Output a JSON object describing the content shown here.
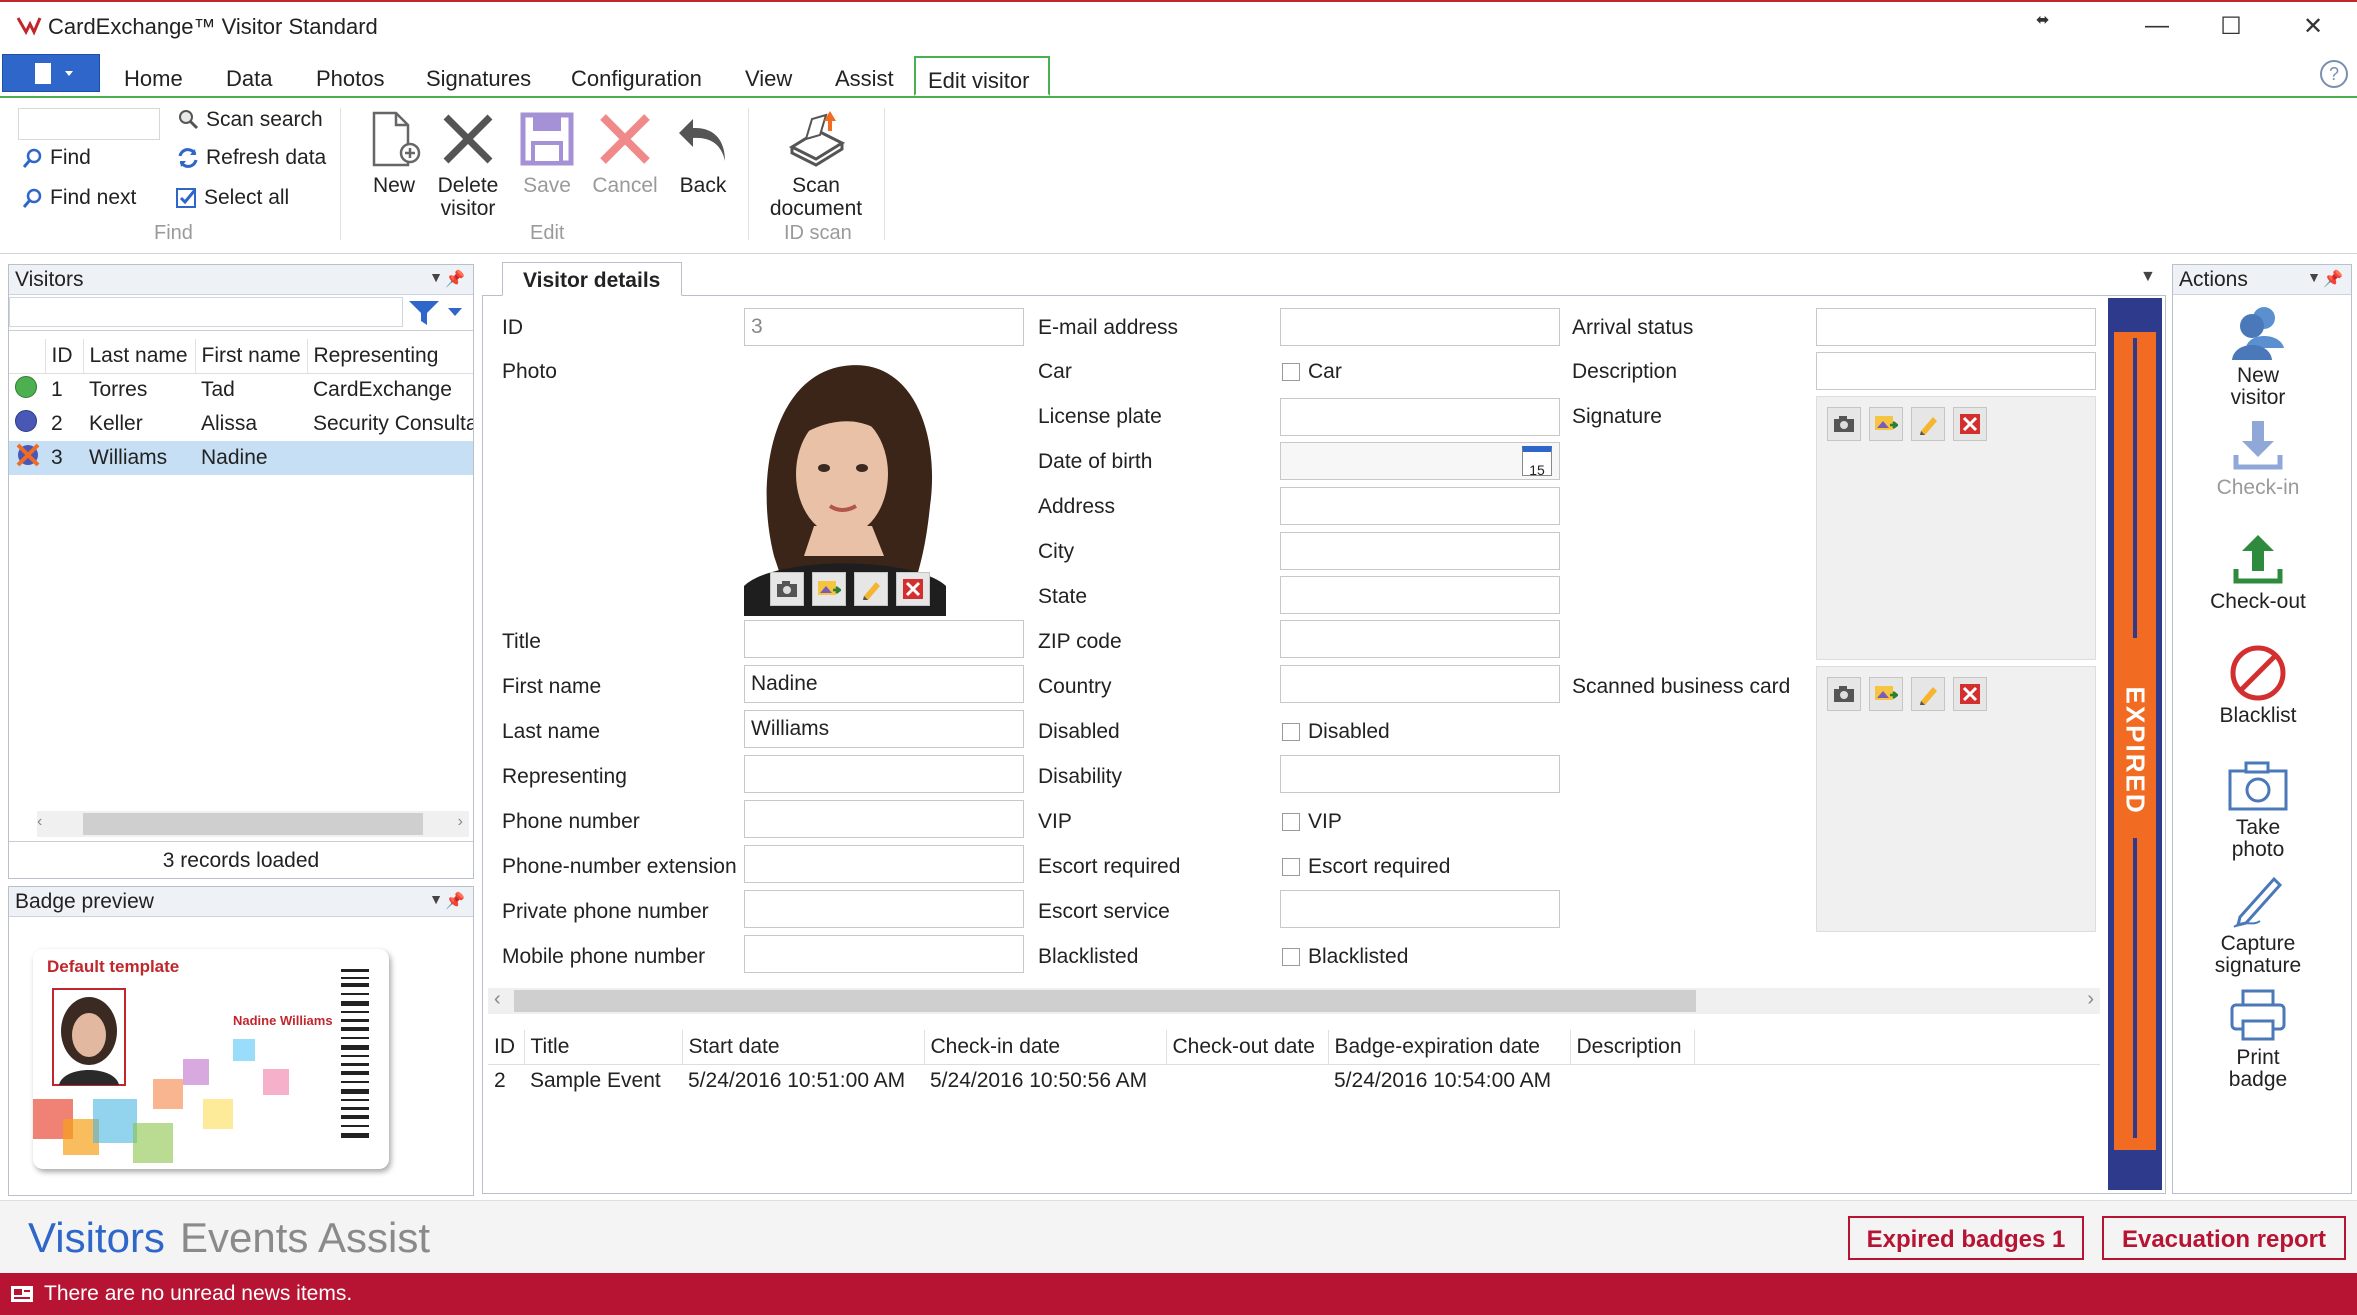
{
  "window": {
    "title": "CardExchange™ Visitor Standard",
    "minimize": "—",
    "maximize": "☐",
    "close": "✕"
  },
  "ribbon": {
    "tabs": [
      "Home",
      "Data",
      "Photos",
      "Signatures",
      "Configuration",
      "View",
      "Assist",
      "Edit visitor"
    ],
    "help": "?",
    "find": {
      "find_label": "Find",
      "find_next_label": "Find next",
      "scan_search_label": "Scan search",
      "refresh_label": "Refresh data",
      "select_all_label": "Select all",
      "group_label": "Find"
    },
    "edit": {
      "new_label": "New",
      "delete_label": "Delete\nvisitor",
      "save_label": "Save",
      "cancel_label": "Cancel",
      "back_label": "Back",
      "group_label": "Edit"
    },
    "idscan": {
      "scan_label": "Scan\ndocument",
      "group_label": "ID scan"
    }
  },
  "visitors_panel": {
    "title": "Visitors",
    "columns": [
      "ID",
      "Last name",
      "First name",
      "Representing"
    ],
    "rows": [
      {
        "id": "1",
        "last": "Torres",
        "first": "Tad",
        "rep": "CardExchange",
        "status_color": "#4caf50"
      },
      {
        "id": "2",
        "last": "Keller",
        "first": "Alissa",
        "rep": "Security Consulta",
        "status_color": "#4a58b5"
      },
      {
        "id": "3",
        "last": "Williams",
        "first": "Nadine",
        "rep": "",
        "status_color": "#e06020"
      }
    ],
    "footer": "3 records loaded"
  },
  "badge_panel": {
    "title": "Badge preview",
    "template_label": "Default template",
    "badge_name": "Nadine Williams"
  },
  "details": {
    "tab_label": "Visitor details",
    "col1": {
      "id_label": "ID",
      "id_value": "3",
      "photo_label": "Photo",
      "title_label": "Title",
      "title_value": "",
      "first_label": "First name",
      "first_value": "Nadine",
      "last_label": "Last name",
      "last_value": "Williams",
      "rep_label": "Representing",
      "rep_value": "",
      "phone_label": "Phone number",
      "phone_value": "",
      "ext_label": "Phone-number extension",
      "ext_value": "",
      "private_label": "Private phone number",
      "private_value": "",
      "mobile_label": "Mobile phone number",
      "mobile_value": ""
    },
    "col2": {
      "email_label": "E-mail address",
      "car_label": "Car",
      "car_cb": "Car",
      "plate_label": "License plate",
      "dob_label": "Date of birth",
      "dob_cal": "15",
      "address_label": "Address",
      "city_label": "City",
      "state_label": "State",
      "zip_label": "ZIP code",
      "country_label": "Country",
      "disabled_label": "Disabled",
      "disabled_cb": "Disabled",
      "disability_label": "Disability",
      "vip_label": "VIP",
      "vip_cb": "VIP",
      "escort_req_label": "Escort required",
      "escort_req_cb": "Escort required",
      "escort_srv_label": "Escort service",
      "blacklisted_label": "Blacklisted",
      "blacklisted_cb": "Blacklisted"
    },
    "col3": {
      "arrival_label": "Arrival status",
      "desc_label": "Description",
      "signature_label": "Signature",
      "card_label": "Scanned business card"
    },
    "expired_text": "EXPIRED"
  },
  "events_table": {
    "columns": [
      "ID",
      "Title",
      "Start date",
      "Check-in date",
      "Check-out date",
      "Badge-expiration date",
      "Description"
    ],
    "rows": [
      [
        "2",
        "Sample Event",
        "5/24/2016 10:51:00 AM",
        "5/24/2016 10:50:56 AM",
        "",
        "5/24/2016 10:54:00 AM",
        ""
      ]
    ]
  },
  "actions_panel": {
    "title": "Actions",
    "items": [
      "New\nvisitor",
      "Check-in",
      "Check-out",
      "Blacklist",
      "Take\nphoto",
      "Capture\nsignature",
      "Print\nbadge"
    ]
  },
  "bottom_nav": {
    "tabs": [
      "Visitors",
      "Events",
      "Assist"
    ],
    "expired_button": "Expired badges 1",
    "evac_button": "Evacuation report"
  },
  "status": {
    "text": "There are no unread news items."
  },
  "colors": {
    "accent_green": "#4caf50",
    "expired_orange": "#f26b22",
    "expired_navy": "#2e3a8c",
    "status_red": "#b71434",
    "selection": "#c7dff5"
  }
}
